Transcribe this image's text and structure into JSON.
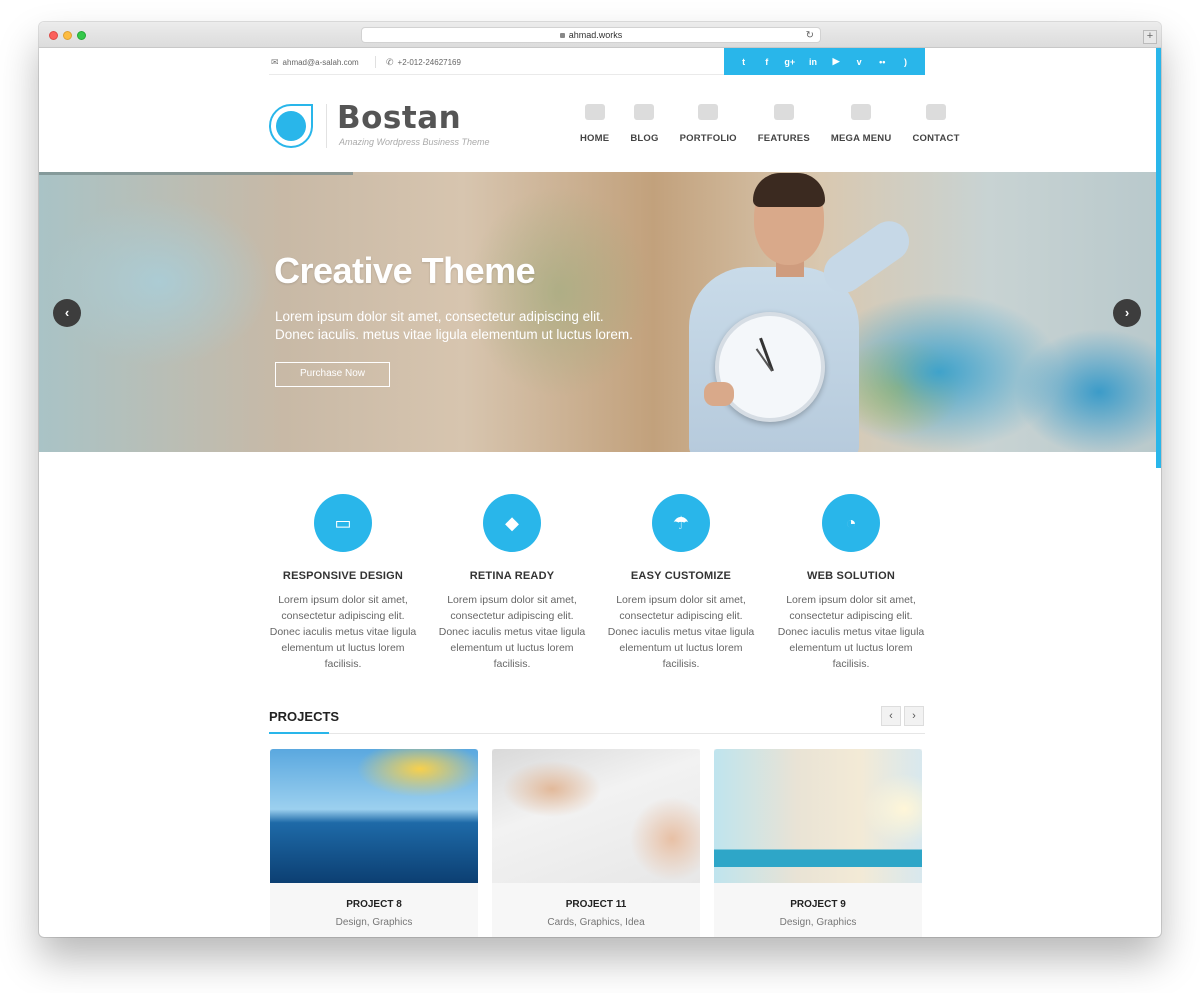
{
  "browser": {
    "url": "ahmad.works"
  },
  "topbar": {
    "email": "ahmad@a-salah.com",
    "phone": "+2-012-24627169",
    "social_icons": [
      "twitter-icon",
      "facebook-icon",
      "google-plus-icon",
      "linkedin-icon",
      "youtube-icon",
      "vimeo-icon",
      "flickr-icon",
      "rss-icon"
    ],
    "social_glyphs": [
      "t",
      "f",
      "g+",
      "in",
      "▶",
      "v",
      "••",
      ")"
    ]
  },
  "brand": {
    "name": "Bostan",
    "tagline": "Amazing Wordpress Business Theme"
  },
  "nav": [
    {
      "label": "HOME",
      "icon": "home-icon"
    },
    {
      "label": "BLOG",
      "icon": "pencil-icon"
    },
    {
      "label": "PORTFOLIO",
      "icon": "camera-icon"
    },
    {
      "label": "FEATURES",
      "icon": "puzzle-icon"
    },
    {
      "label": "MEGA MENU",
      "icon": "archive-icon"
    },
    {
      "label": "CONTACT",
      "icon": "paper-plane-icon"
    }
  ],
  "hero": {
    "title": "Creative Theme",
    "line1": "Lorem ipsum dolor sit amet, consectetur adipiscing elit.",
    "line2": "Donec iaculis. metus vitae ligula elementum ut luctus lorem.",
    "button": "Purchase Now",
    "prev": "‹",
    "next": "›"
  },
  "features": [
    {
      "title": "RESPONSIVE DESIGN",
      "icon": "monitor-icon",
      "text": "Lorem ipsum dolor sit amet, consectetur adipiscing elit. Donec iaculis metus vitae ligula elementum ut luctus lorem facilisis."
    },
    {
      "title": "RETINA READY",
      "icon": "diamond-icon",
      "text": "Lorem ipsum dolor sit amet, consectetur adipiscing elit. Donec iaculis metus vitae ligula elementum ut luctus lorem facilisis."
    },
    {
      "title": "EASY CUSTOMIZE",
      "icon": "umbrella-icon",
      "text": "Lorem ipsum dolor sit amet, consectetur adipiscing elit. Donec iaculis metus vitae ligula elementum ut luctus lorem facilisis."
    },
    {
      "title": "WEB SOLUTION",
      "icon": "satellite-icon",
      "text": "Lorem ipsum dolor sit amet, consectetur adipiscing elit. Donec iaculis metus vitae ligula elementum ut luctus lorem facilisis."
    }
  ],
  "projects": {
    "heading": "PROJECTS",
    "prev": "‹",
    "next": "›",
    "items": [
      {
        "name": "PROJECT 8",
        "categories": "Design, Graphics"
      },
      {
        "name": "PROJECT 11",
        "categories": "Cards, Graphics, Idea"
      },
      {
        "name": "PROJECT 9",
        "categories": "Design, Graphics"
      }
    ]
  },
  "colors": {
    "accent": "#29b6ea",
    "text_dark": "#333333",
    "text_muted": "#666666"
  }
}
